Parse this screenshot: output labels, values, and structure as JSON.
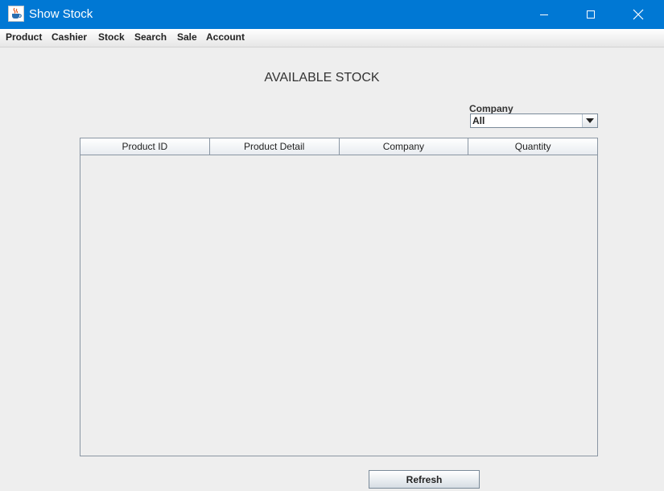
{
  "window": {
    "title": "Show Stock",
    "icon": "java-cup-icon"
  },
  "menu": {
    "items": [
      {
        "label": "Product"
      },
      {
        "label": "Cashier"
      },
      {
        "label": "Stock"
      },
      {
        "label": "Search"
      },
      {
        "label": "Sale"
      },
      {
        "label": "Account"
      }
    ]
  },
  "main": {
    "title": "AVAILABLE STOCK",
    "filter": {
      "label": "Company",
      "selected": "All"
    },
    "table": {
      "columns": [
        "Product ID",
        "Product Detail",
        "Company",
        "Quantity"
      ],
      "rows": []
    },
    "refresh_label": "Refresh"
  },
  "colors": {
    "titlebar": "#0078d4",
    "background": "#eeeeee",
    "border": "#8a96a3"
  }
}
